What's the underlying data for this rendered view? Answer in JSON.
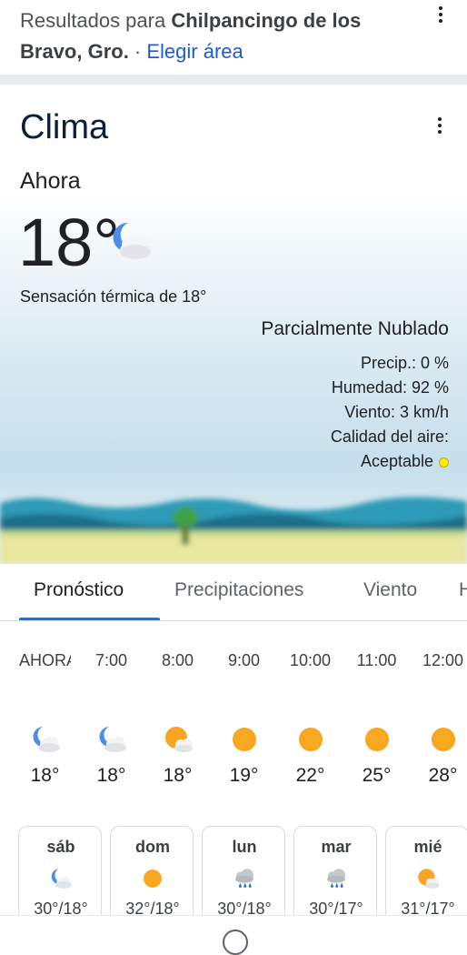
{
  "results": {
    "prefix": "Resultados para ",
    "location": "Chilpancingo de los Bravo, Gro.",
    "separator": " · ",
    "change_area": "Elegir área",
    "menu_icon": "more-vert-icon"
  },
  "weather": {
    "title": "Clima",
    "menu_icon": "more-vert-icon",
    "now_label": "Ahora",
    "temperature": "18°",
    "now_icon": "partly-cloudy-night-icon",
    "feels_like": "Sensación térmica de 18°",
    "condition": "Parcialmente Nublado",
    "precip": "Precip.: 0 %",
    "humidity": "Humedad: 92 %",
    "wind": "Viento: 3 km/h",
    "air_quality_label": "Calidad del aire:",
    "air_quality_value": "Aceptable",
    "air_quality_color": "#ffea00"
  },
  "tabs": [
    {
      "label": "Pronóstico",
      "active": true
    },
    {
      "label": "Precipitaciones",
      "active": false
    },
    {
      "label": "Viento",
      "active": false
    },
    {
      "label": "H",
      "active": false
    }
  ],
  "hourly": [
    {
      "time": "AHORA",
      "icon": "partly-cloudy-night-icon",
      "temp": "18°"
    },
    {
      "time": "7:00",
      "icon": "partly-cloudy-night-icon",
      "temp": "18°"
    },
    {
      "time": "8:00",
      "icon": "partly-cloudy-day-icon",
      "temp": "18°"
    },
    {
      "time": "9:00",
      "icon": "sunny-icon",
      "temp": "19°"
    },
    {
      "time": "10:00",
      "icon": "sunny-icon",
      "temp": "22°"
    },
    {
      "time": "11:00",
      "icon": "sunny-icon",
      "temp": "25°"
    },
    {
      "time": "12:00",
      "icon": "sunny-icon",
      "temp": "28°"
    }
  ],
  "daily": [
    {
      "day": "sáb",
      "icon": "partly-cloudy-night-icon",
      "temps": "30°/18°"
    },
    {
      "day": "dom",
      "icon": "sunny-icon",
      "temps": "32°/18°"
    },
    {
      "day": "lun",
      "icon": "rain-icon",
      "temps": "30°/18°"
    },
    {
      "day": "mar",
      "icon": "rain-icon",
      "temps": "30°/17°"
    },
    {
      "day": "mié",
      "icon": "partly-cloudy-day-icon",
      "temps": "31°/17°"
    }
  ],
  "colors": {
    "accent": "#1a73e8",
    "link": "#1a5cd8",
    "sun": "#f6a623",
    "moon": "#4a8fe7"
  }
}
